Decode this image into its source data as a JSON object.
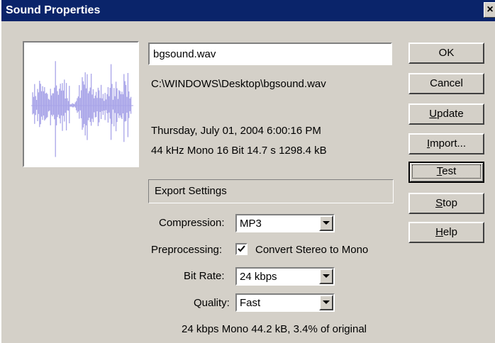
{
  "window": {
    "title": "Sound Properties",
    "close_glyph": "×"
  },
  "file": {
    "name": "bgsound.wav",
    "path": "C:\\WINDOWS\\Desktop\\bgsound.wav",
    "date": "Thursday, July 01, 2004  6:00:16 PM",
    "info": "44 kHz Mono 16 Bit 14.7 s 1298.4 kB"
  },
  "buttons": {
    "ok": "OK",
    "cancel": "Cancel",
    "update": {
      "accel": "U",
      "rest": "pdate"
    },
    "import": {
      "accel": "I",
      "rest": "mport..."
    },
    "test": {
      "accel": "T",
      "rest": "est"
    },
    "stop": {
      "accel": "S",
      "rest": "top"
    },
    "help": {
      "accel": "H",
      "rest": "elp"
    }
  },
  "export": {
    "group_label": "Export Settings",
    "compression_label": "Compression:",
    "compression_value": "MP3",
    "preprocessing_label": "Preprocessing:",
    "preprocessing_checked": true,
    "preprocessing_option": "Convert Stereo to Mono",
    "bitrate_label": "Bit Rate:",
    "bitrate_value": "24 kbps",
    "quality_label": "Quality:",
    "quality_value": "Fast",
    "summary": "24 kbps Mono 44.2 kB, 3.4% of original"
  },
  "colors": {
    "title_bar": "#0a246a",
    "waveform": "#a8a4e8",
    "face": "#d4d0c8"
  },
  "icons": {
    "close": "close-icon",
    "dropdown": "dropdown-arrow-icon",
    "check": "checkmark-icon"
  }
}
